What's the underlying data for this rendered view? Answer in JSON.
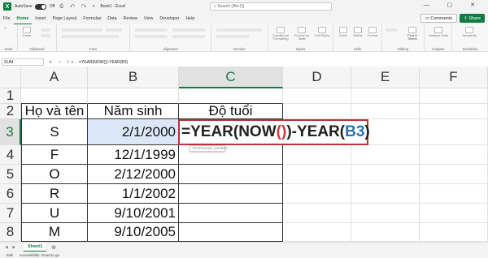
{
  "titlebar": {
    "logo": "X",
    "autosave_label": "AutoSave",
    "toggle_state": "Off",
    "quick_icons": "⎙ ↶ ↷ ▾",
    "book_name": "Book1 - Excel",
    "search_placeholder": "Search (Alt+Q)",
    "window_controls": "— ▢ ✕"
  },
  "menu": {
    "items": [
      "File",
      "Home",
      "Insert",
      "Page Layout",
      "Formulas",
      "Data",
      "Review",
      "View",
      "Developer",
      "Help"
    ],
    "active": "Home",
    "comments_label": "Comments",
    "share_label": "Share"
  },
  "ribbon": {
    "groups": [
      "Undo",
      "Clipboard",
      "Font",
      "Alignment",
      "Number",
      "Styles",
      "Cells",
      "Editing",
      "Analysis",
      "Sensitivity"
    ],
    "buttons": {
      "paste": "Paste",
      "conditional": "Conditional Formatting",
      "format_table": "Format as Table",
      "cell_styles": "Cell Styles",
      "insert": "Insert",
      "delete": "Delete",
      "format": "Format",
      "find_select": "Find & Select",
      "analyze": "Analyze Data",
      "sensitivity": "Sensitivity"
    }
  },
  "formula_bar": {
    "name_box": "SUM",
    "fx_icons": "✕ ✓ fx",
    "formula": "=YEAR(NOW())-YEAR(B3)"
  },
  "grid": {
    "columns": [
      "A",
      "B",
      "C",
      "D",
      "E",
      "F"
    ],
    "rows": [
      "1",
      "2",
      "3",
      "4",
      "5",
      "6",
      "7",
      "8"
    ],
    "headers": {
      "a": "Họ và tên",
      "b": "Năm sinh",
      "c": "Độ tuổi"
    },
    "data": [
      {
        "name": "S",
        "year": "2/1/2000"
      },
      {
        "name": "F",
        "year": "12/1/1999"
      },
      {
        "name": "O",
        "year": "2/12/2000"
      },
      {
        "name": "R",
        "year": "1/1/2002"
      },
      {
        "name": "U",
        "year": "9/10/2001"
      },
      {
        "name": "M",
        "year": "9/10/2005"
      }
    ],
    "edit_formula": {
      "p1": "=YEAR(NOW",
      "p2": "()",
      "p3": ")-YEAR(",
      "p4": "B3",
      "p5": ")"
    },
    "tooltip": "YEAR(serial_number)",
    "colors": {
      "paren": "#d23a3a",
      "ref": "#2f6fb4",
      "accent": "#107c41",
      "box": "#b7343a"
    }
  },
  "sheets": {
    "nav": "◀ ▶",
    "tabs": [
      "Sheet1"
    ],
    "add": "⊕"
  },
  "status": {
    "mode": "Edit",
    "accessibility": "Accessibility: Good to go"
  }
}
